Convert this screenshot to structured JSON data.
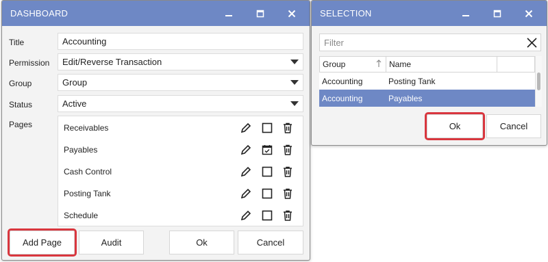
{
  "dashboard": {
    "title": "DASHBOARD",
    "fields": {
      "title_label": "Title",
      "title_value": "Accounting",
      "permission_label": "Permission",
      "permission_value": "Edit/Reverse Transaction",
      "group_label": "Group",
      "group_value": "Group",
      "status_label": "Status",
      "status_value": "Active",
      "pages_label": "Pages"
    },
    "pages": [
      {
        "name": "Receivables",
        "checked": false
      },
      {
        "name": "Payables",
        "checked": true
      },
      {
        "name": "Cash Control",
        "checked": false
      },
      {
        "name": "Posting Tank",
        "checked": false
      },
      {
        "name": "Schedule",
        "checked": false
      }
    ],
    "buttons": {
      "add_page": "Add Page",
      "audit": "Audit",
      "ok": "Ok",
      "cancel": "Cancel"
    }
  },
  "selection": {
    "title": "SELECTION",
    "filter_placeholder": "Filter",
    "columns": {
      "group": "Group",
      "name": "Name"
    },
    "rows": [
      {
        "group": "Accounting",
        "name": "Posting Tank",
        "selected": false
      },
      {
        "group": "Accounting",
        "name": "Payables",
        "selected": true
      }
    ],
    "buttons": {
      "ok": "Ok",
      "cancel": "Cancel"
    }
  },
  "colors": {
    "titlebar": "#6e88c5",
    "selected_row": "#6e88c5",
    "highlight": "#d9363e"
  }
}
